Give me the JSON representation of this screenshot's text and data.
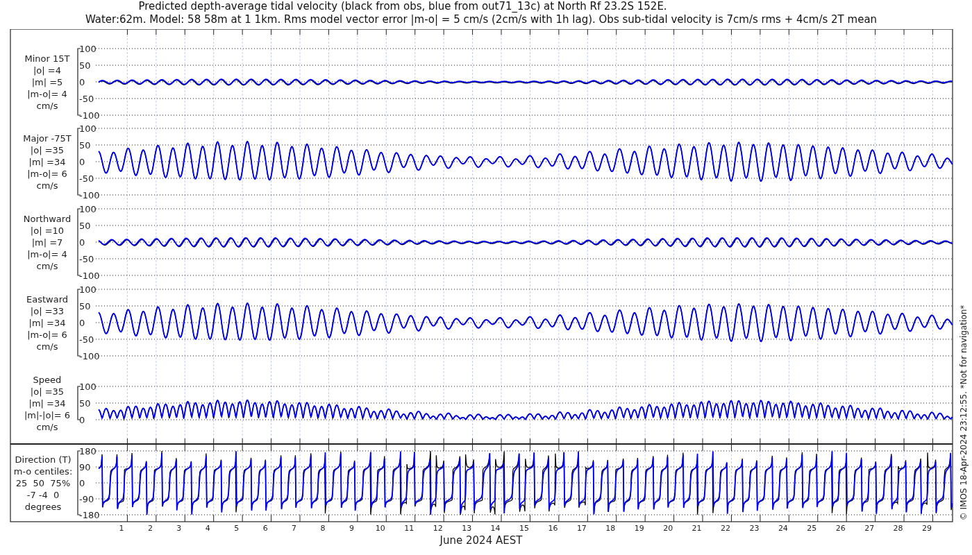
{
  "title_lines": [
    "Predicted depth-average tidal velocity (black from obs, blue from out71_13c) at North Rf 23.2S 152E.",
    "Water:62m. Model: 58 58m at 1 1km. Rms model vector error |m-o| = 5 cm/s (2cm/s with 1h lag). Obs sub-tidal velocity is 7cm/s rms + 4cm/s 2T mean"
  ],
  "panels": [
    {
      "kind": "minor",
      "label_lines": [
        "Minor 15T",
        "|o| =4",
        "|m| =5",
        "|m-o|= 4",
        "cm/s"
      ],
      "yticks": [
        "100",
        "50",
        "0",
        "-50",
        "-100"
      ]
    },
    {
      "kind": "major",
      "label_lines": [
        "Major -75T",
        "|o| =35",
        "|m| =34",
        "|m-o|= 6",
        "cm/s"
      ],
      "yticks": [
        "100",
        "50",
        "0",
        "-50",
        "-100"
      ]
    },
    {
      "kind": "northward",
      "label_lines": [
        "Northward",
        "|o| =10",
        "|m| =7",
        "|m-o|= 4",
        "cm/s"
      ],
      "yticks": [
        "100",
        "50",
        "0",
        "-50",
        "-100"
      ]
    },
    {
      "kind": "eastward",
      "label_lines": [
        "Eastward",
        "|o| =33",
        "|m| =34",
        "|m-o|= 6",
        "cm/s"
      ],
      "yticks": [
        "100",
        "50",
        "0",
        "-50",
        "-100"
      ]
    },
    {
      "kind": "speed",
      "label_lines": [
        "Speed",
        "|o| =35",
        "|m| =34",
        "|m|-|o|= 6",
        "cm/s"
      ],
      "yticks": [
        "100",
        "50",
        "0"
      ]
    },
    {
      "kind": "direction",
      "label_lines": [
        "Direction (T)",
        "m-o centiles:",
        "25  50  75%",
        "-7 -4  0",
        "degrees"
      ],
      "yticks": [
        "180",
        "90",
        "0",
        "-90",
        "-180"
      ]
    }
  ],
  "xticks": [
    "1",
    "2",
    "3",
    "4",
    "5",
    "6",
    "7",
    "8",
    "9",
    "10",
    "11",
    "12",
    "13",
    "14",
    "15",
    "16",
    "17",
    "18",
    "19",
    "20",
    "21",
    "22",
    "23",
    "24",
    "25",
    "26",
    "27",
    "28",
    "29"
  ],
  "xlabel": "June 2024 AEST",
  "side_note": "© IMOS 18-Apr-2024 23:12:55. *Not for navigation*"
}
